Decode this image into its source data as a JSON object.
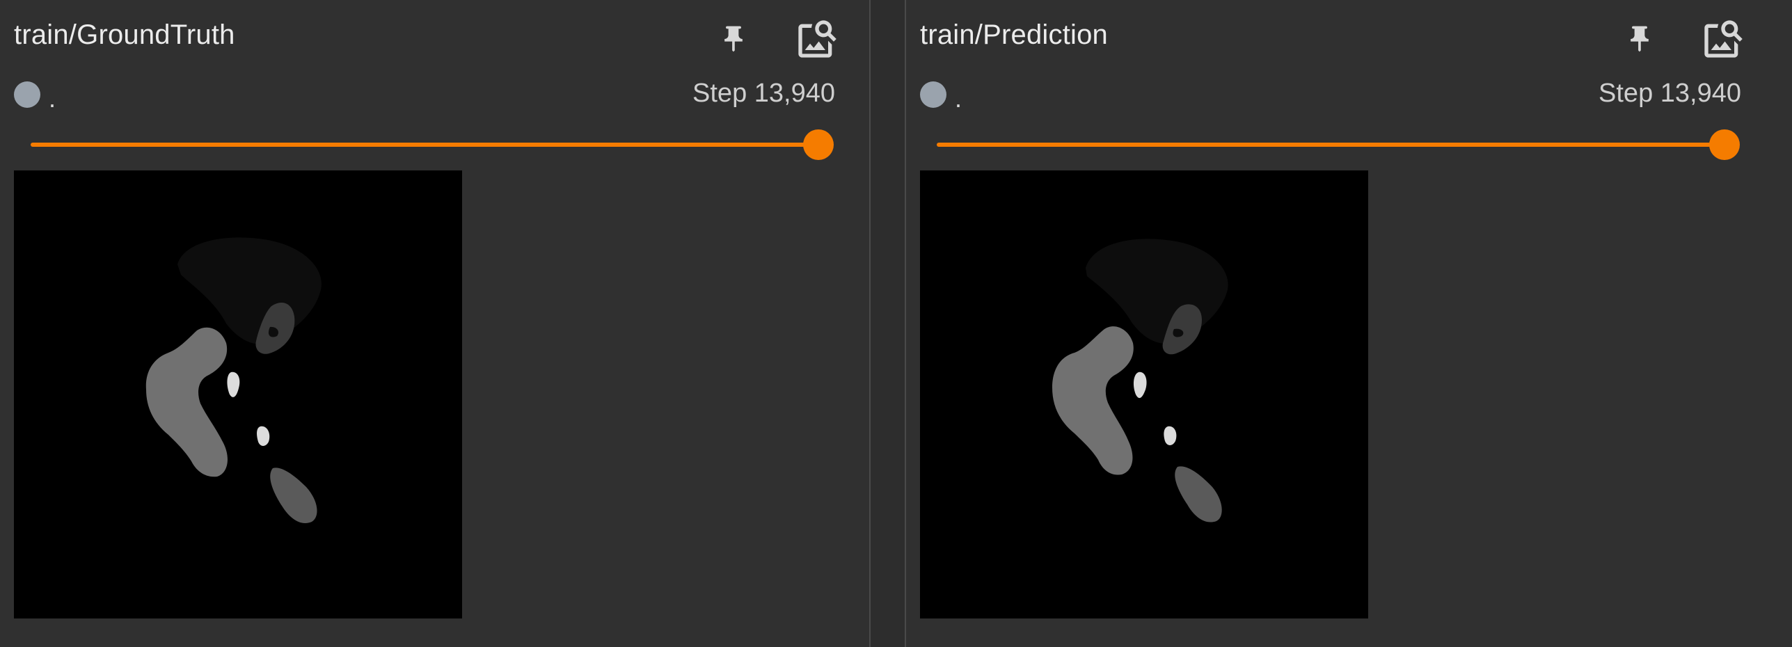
{
  "cards": [
    {
      "title": "train/GroundTruth",
      "run_name": ".",
      "step_text": "Step 13,940",
      "pin_icon": "pin-icon",
      "zoom_icon": "image-search-icon"
    },
    {
      "title": "train/Prediction",
      "run_name": ".",
      "step_text": "Step 13,940",
      "pin_icon": "pin-icon",
      "zoom_icon": "image-search-icon"
    }
  ],
  "colors": {
    "background": "#303030",
    "accent": "#f57c00",
    "run_dot": "#9aa3ad",
    "image_background": "#000000"
  }
}
